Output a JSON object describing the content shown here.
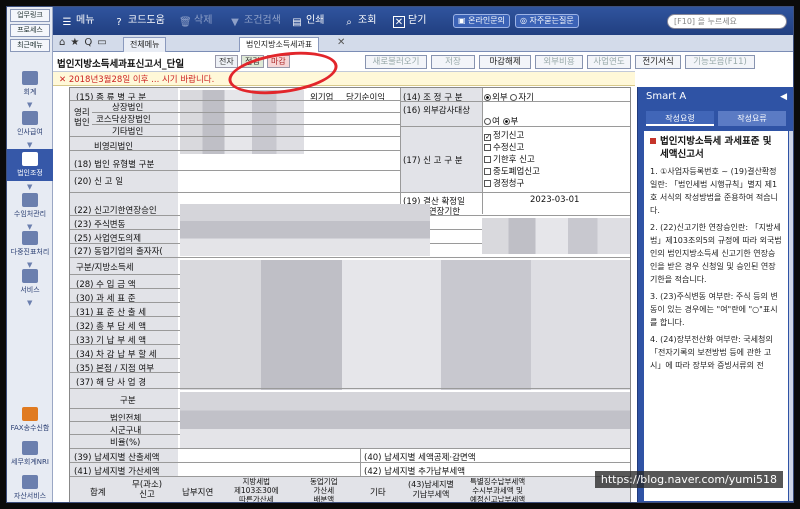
{
  "rail": {
    "top_tabs": [
      "업무링크",
      "프로세스",
      "최근메뉴"
    ],
    "items": [
      "회계",
      "인사급여",
      "법인조정",
      "수임처관리",
      "다중진표처리",
      "서비스",
      "FAX송수신함",
      "세무회계NRI",
      "자산서비스"
    ],
    "active_index": 2
  },
  "toolbar": {
    "menu": "메뉴",
    "code_help": "코드도움",
    "delete": "삭제",
    "condition_search": "조건검색",
    "print": "인쇄",
    "inquiry": "조회",
    "close": "닫기",
    "online_inquiry": "온라인문의",
    "faq": "자주묻는질문",
    "search_placeholder": "[F10] 을 누르세요"
  },
  "tabs": {
    "all_menu": "전체메뉴",
    "active_tab": "법인지방소득세과표"
  },
  "doc": {
    "title": "법인지방소득세과표신고서_단일",
    "status_badges": [
      "전자",
      "점검",
      "마감"
    ],
    "actions": [
      "새로불러오기",
      "저장",
      "마감해제",
      "외부비용",
      "사업연도",
      "전기서식",
      "기능모음(F11)"
    ]
  },
  "notice": "✕ 2018년3월28일 이후 ... 시기 바랍니다.",
  "form": {
    "labels": {
      "r15": "(15) 종 류 별 구 분",
      "listed": "상장법인",
      "kosdaq": "코스닥상장법인",
      "other": "기타법인",
      "nonprofit": "비영리법인",
      "profit_cols": [
        "외기업",
        "당기순이익"
      ],
      "r14": "(14) 조 정 구 분",
      "r14_opts": [
        "외부",
        "자기"
      ],
      "r16": "(16) 외부감사대상",
      "r16_opts": [
        "여",
        "부"
      ],
      "r17": "(17) 신 고 구 분",
      "r17_opts": [
        "정기신고",
        "수정신고",
        "기한후 신고",
        "중도폐업신고",
        "경정청구"
      ],
      "r18": "(18) 법인 유형별 구분",
      "r20": "(20) 신 고 일",
      "r19": "(19) 결산 확정일",
      "r19_value": "2023-03-01",
      "r22": "(22) 신고기한연장승인",
      "extend": "2. 연장기한",
      "r23": "(23) 주식변동",
      "r25": "(25) 사업연도의제",
      "r27": "(27) 동업기업의 출자자(",
      "section": "구분/지방소득세",
      "r28": "(28) 수 입 금 액",
      "r30": "(30) 과 세 표 준",
      "r31": "(31) 표 준 산 출 세",
      "r32": "(32) 총 부 담 세 액",
      "r33": "(33) 기 납 부 세 액",
      "r34": "(34) 차 감 납 부 할 세",
      "r35": "(35) 본점 / 지점 여부",
      "r37": "(37) 해 당 사 업 경",
      "sub_head": "구분",
      "corp_total": "법인전체",
      "in_city": "시군구내",
      "ratio": "비율(%)",
      "r39": "(39) 납세지별 산출세액",
      "r40": "(40) 납세지별 세액공제·감면액",
      "r41": "(41) 납세지별 가산세액",
      "r42": "(42) 납세지별 추가납부세액",
      "bottom_cols": [
        "합계",
        "무(과소)\n신고",
        "납부지연",
        "지방세법\n제103조30에\n따른가산세",
        "동업기업\n가산세\n배분액",
        "기타",
        "(43)납세지별\n기납부세액",
        "특별징수납부세액\n수시부과세액 및\n예정신고납부세액"
      ]
    }
  },
  "smart": {
    "title": "Smart A",
    "tabs": [
      "작성요령",
      "작성요류"
    ],
    "heading": "법인지방소득세 과세표준 및 세액신고서",
    "items": [
      "1. ①사업자등록번호 ~ (19)결산확정일란: 「법인세법 시행규칙」별지 제1호 서식의 작성방법을 준용하여 적습니다.",
      "2. (22)신고기한 연장승인란: 「지방세법」제103조의5의 규정에 따라 외국법인의 법인지방소득세 신고기한 연장승인을 받은 경우 신청일 및 승인된 연장기한을 적습니다.",
      "3. (23)주식변동 여부란: 주식 등의 변동이 있는 경우에는 \"여\"란에 \"○\"표시를 합니다.",
      "4. (24)장부전산화 여부란: 국세청의 「전자기록의 보전방법 등에 관한 고시」에 따라 장부와 증빙서류의 전"
    ]
  },
  "watermark": "https://blog.naver.com/yumi518"
}
